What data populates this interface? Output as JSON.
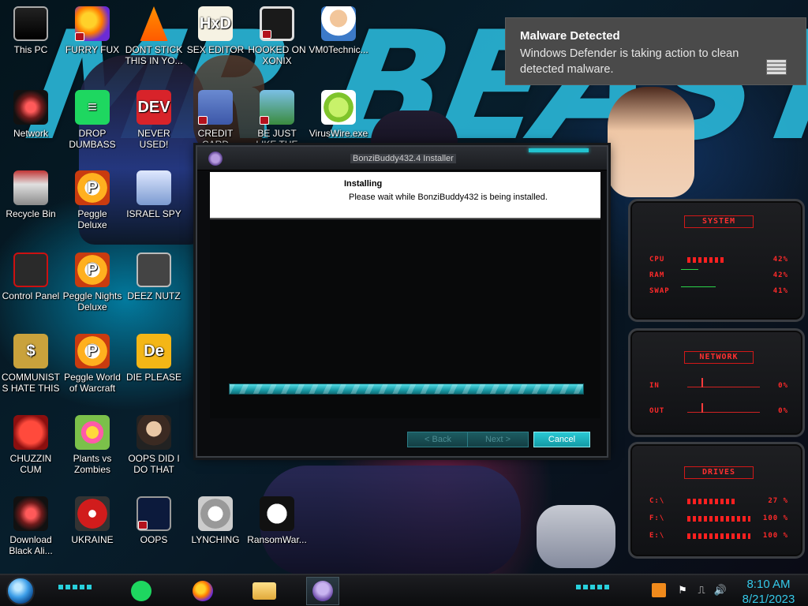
{
  "background": {
    "title_text": "MR BEAST"
  },
  "desktop": {
    "icons": [
      {
        "label": "This PC",
        "glyph": "",
        "icon": "computer-icon"
      },
      {
        "label": "FURRY FUX",
        "glyph": "",
        "icon": "firefox-icon"
      },
      {
        "label": "DONT STICK THIS IN YO...",
        "glyph": "",
        "icon": "vlc-cone-icon"
      },
      {
        "label": "SEX EDITOR",
        "glyph": "HxD",
        "icon": "hex-editor-icon"
      },
      {
        "label": "HOOKED ON XONIX",
        "glyph": "",
        "icon": "maze-game-icon"
      },
      {
        "label": "VM0Technic...",
        "glyph": "",
        "icon": "doctor-icon"
      },
      {
        "label": "Network",
        "glyph": "",
        "icon": "network-icon"
      },
      {
        "label": "DROP DUMBASS",
        "glyph": "≡",
        "icon": "spotify-icon"
      },
      {
        "label": "NEVER USED!",
        "glyph": "DEV",
        "icon": "dev-cpp-icon"
      },
      {
        "label": "CREDIT CARD CHECKER",
        "glyph": "",
        "icon": "credit-card-icon"
      },
      {
        "label": "BE JUST LIKE THE DUDE!",
        "glyph": "",
        "icon": "elf-icon"
      },
      {
        "label": "VirusWire.exe",
        "glyph": "",
        "icon": "lime-icon"
      },
      {
        "label": "Recycle Bin",
        "glyph": "",
        "icon": "recycle-bin-icon"
      },
      {
        "label": "Peggle Deluxe",
        "glyph": "P",
        "icon": "peggle-icon"
      },
      {
        "label": "ISRAEL SPY",
        "glyph": "",
        "icon": "spy-icon"
      },
      {
        "label": "Control Panel",
        "glyph": "",
        "icon": "control-panel-icon"
      },
      {
        "label": "Peggle Nights Deluxe",
        "glyph": "P",
        "icon": "peggle-nights-icon"
      },
      {
        "label": "DEEZ NUTZ",
        "glyph": "",
        "icon": "stack-icon"
      },
      {
        "label": "COMMUNISTS HATE THIS G...",
        "glyph": "$",
        "icon": "money-bag-icon"
      },
      {
        "label": "Peggle World of Warcraft",
        "glyph": "P",
        "icon": "peggle-wow-icon"
      },
      {
        "label": "DIE PLEASE",
        "glyph": "De",
        "icon": "de-icon"
      },
      {
        "label": "CHUZZIN CUM",
        "glyph": "",
        "icon": "chuzzle-icon"
      },
      {
        "label": "Plants vs Zombies",
        "glyph": "",
        "icon": "pvz-icon"
      },
      {
        "label": "OOPS DID I DO THAT",
        "glyph": "",
        "icon": "portrait-icon"
      },
      {
        "label": "Download Black Ali...",
        "glyph": "",
        "icon": "download-icon"
      },
      {
        "label": "UKRAINE",
        "glyph": "",
        "icon": "radiation-icon"
      },
      {
        "label": "OOPS",
        "glyph": "",
        "icon": "oops-icon"
      },
      {
        "label": "LYNCHING",
        "glyph": "",
        "icon": "lynching-icon"
      },
      {
        "label": "RansomWar...",
        "glyph": "",
        "icon": "skull-icon"
      }
    ]
  },
  "notification": {
    "title": "Malware Detected",
    "body": "Windows Defender is taking action to clean detected malware."
  },
  "installer": {
    "window_title": "BonziBuddy432.4 Installer",
    "heading": "Installing",
    "subheading": "Please wait while BonziBuddy432 is being installed.",
    "progress": 1.0,
    "back_label": "< Back",
    "next_label": "Next >",
    "cancel_label": "Cancel"
  },
  "monitor": {
    "system": {
      "title": "SYSTEM",
      "rows": [
        {
          "label": "CPU",
          "value": "42%"
        },
        {
          "label": "RAM",
          "value": "42%"
        },
        {
          "label": "SWAP",
          "value": "41%"
        }
      ]
    },
    "network": {
      "title": "NETWORK",
      "rows": [
        {
          "label": "IN",
          "value": "0%"
        },
        {
          "label": "OUT",
          "value": "0%"
        }
      ]
    },
    "drives": {
      "title": "DRIVES",
      "rows": [
        {
          "label": "C:\\",
          "value": "27 %"
        },
        {
          "label": "F:\\",
          "value": "100 %"
        },
        {
          "label": "E:\\",
          "value": "100 %"
        }
      ]
    },
    "colors": {
      "accent": "#ff2a2a",
      "frame": "#3a3d42"
    }
  },
  "taskbar": {
    "apps": [
      {
        "name": "Spotify",
        "icon": "spotify-icon"
      },
      {
        "name": "Firefox",
        "icon": "firefox-icon"
      },
      {
        "name": "File Explorer",
        "icon": "folder-icon"
      },
      {
        "name": "BonziBuddy Installer",
        "icon": "bonzi-icon"
      }
    ],
    "tray": {
      "volume": "🔊",
      "network": "⎍",
      "flag": "⚑",
      "chevron": "▲"
    },
    "clock": {
      "time": "8:10 AM",
      "date": "8/21/2023"
    }
  },
  "colors": {
    "accent_cyan": "#22c3cf",
    "toast_bg": "#4a4a4a",
    "clock": "#34c8e8"
  }
}
